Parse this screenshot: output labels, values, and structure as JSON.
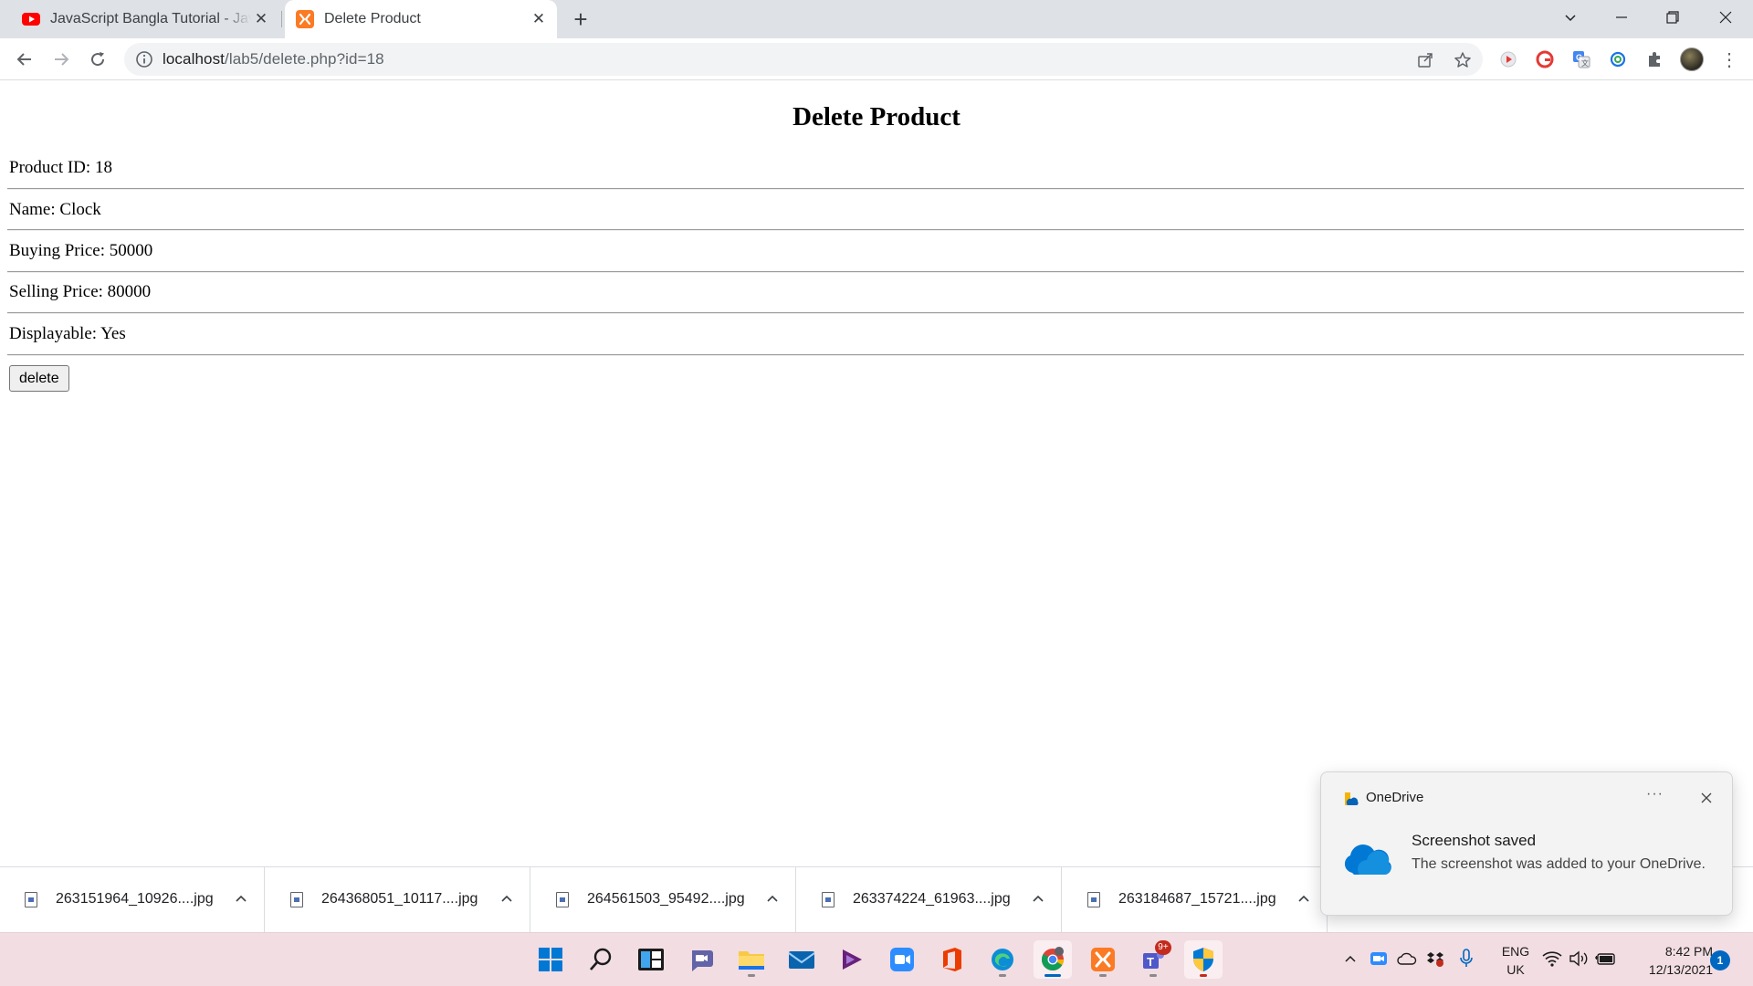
{
  "browser": {
    "tabs": [
      {
        "title": "JavaScript Bangla Tutorial - JavaScript",
        "icon": "youtube-icon",
        "active": false
      },
      {
        "title": "Delete Product",
        "icon": "xampp-icon",
        "active": true
      }
    ],
    "url_host": "localhost",
    "url_path": "/lab5/delete.php?id=18"
  },
  "page": {
    "title": "Delete Product",
    "fields": [
      {
        "label": "Product ID: ",
        "value": "18"
      },
      {
        "label": "Name: ",
        "value": "Clock"
      },
      {
        "label": "Buying Price: ",
        "value": "50000"
      },
      {
        "label": "Selling Price: ",
        "value": "80000"
      },
      {
        "label": "Displayable: ",
        "value": "Yes"
      }
    ],
    "delete_label": "delete"
  },
  "downloads": [
    {
      "name": "263151964_10926....jpg"
    },
    {
      "name": "264368051_10117....jpg"
    },
    {
      "name": "264561503_95492....jpg"
    },
    {
      "name": "263374224_61963....jpg"
    },
    {
      "name": "263184687_15721....jpg"
    }
  ],
  "toast": {
    "app": "OneDrive",
    "more": "···",
    "title": "Screenshot saved",
    "body": "The screenshot was added to your OneDrive."
  },
  "taskbar": {
    "apps": [
      "windows-start-icon",
      "search-icon",
      "widgets-icon",
      "teams-chat-icon",
      "file-explorer-icon",
      "mail-icon",
      "visual-studio-icon",
      "zoom-icon",
      "office-icon",
      "edge-icon",
      "chrome-icon",
      "xampp-icon",
      "teams-icon",
      "windows-security-icon"
    ],
    "teams_badge": "9+",
    "lang_line1": "ENG",
    "lang_line2": "UK",
    "time": "8:42 PM",
    "date": "12/13/2021",
    "notifications": "1"
  },
  "colors": {
    "accent": "#0067c0",
    "tabstrip": "#dee1e6",
    "taskbar": "#f2dde2"
  }
}
